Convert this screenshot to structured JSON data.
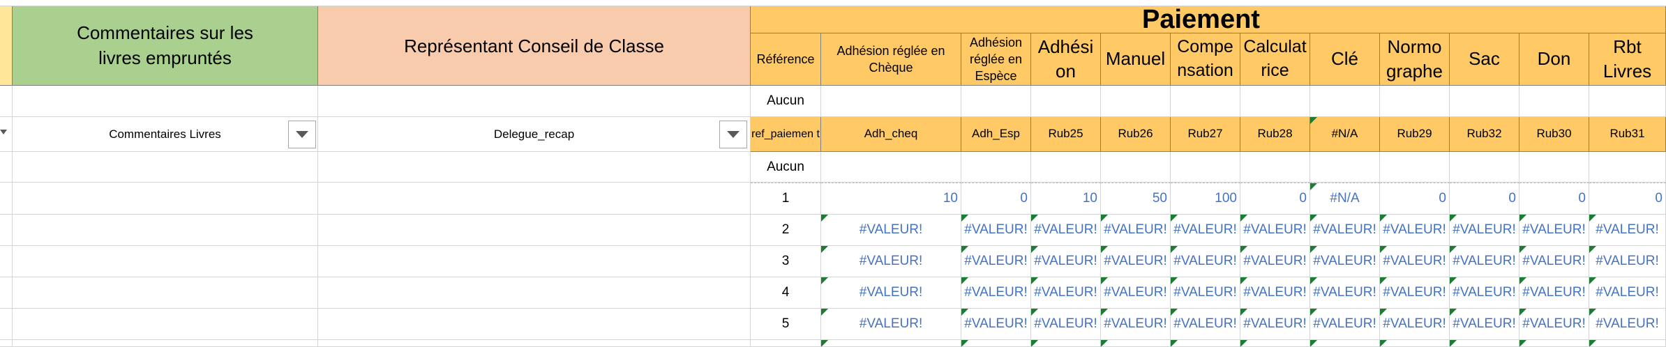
{
  "headers": {
    "commentaires": "Commentaires sur les livres empruntés",
    "representant": "Représentant Conseil de Classe",
    "paiement": "Paiement",
    "columns": [
      "Référence",
      "Adhésion réglée en Chèque",
      "Adhésion réglée en Espèce",
      "Adhési on",
      "Manuel",
      "Compe nsation",
      "Calculat rice",
      "Clé",
      "Normo graphe",
      "Sac",
      "Don",
      "Rbt Livres"
    ]
  },
  "rows": {
    "aucun_top": "Aucun",
    "dropdown_commentaires": "Commentaires Livres",
    "dropdown_delegue": "Delegue_recap",
    "codes": [
      "ref_paiemen t",
      "Adh_cheq",
      "Adh_Esp",
      "Rub25",
      "Rub26",
      "Rub27",
      "Rub28",
      "#N/A",
      "Rub29",
      "Rub32",
      "Rub30",
      "Rub31"
    ],
    "aucun_bottom": "Aucun",
    "data": [
      [
        "1",
        "10",
        "0",
        "10",
        "50",
        "100",
        "0",
        "#N/A",
        "0",
        "0",
        "0",
        "0"
      ],
      [
        "2",
        "#VALEUR!",
        "#VALEUR!",
        "#VALEUR!",
        "#VALEUR!",
        "#VALEUR!",
        "#VALEUR!",
        "#VALEUR!",
        "#VALEUR!",
        "#VALEUR!",
        "#VALEUR!",
        "#VALEUR!"
      ],
      [
        "3",
        "#VALEUR!",
        "#VALEUR!",
        "#VALEUR!",
        "#VALEUR!",
        "#VALEUR!",
        "#VALEUR!",
        "#VALEUR!",
        "#VALEUR!",
        "#VALEUR!",
        "#VALEUR!",
        "#VALEUR!"
      ],
      [
        "4",
        "#VALEUR!",
        "#VALEUR!",
        "#VALEUR!",
        "#VALEUR!",
        "#VALEUR!",
        "#VALEUR!",
        "#VALEUR!",
        "#VALEUR!",
        "#VALEUR!",
        "#VALEUR!",
        "#VALEUR!"
      ],
      [
        "5",
        "#VALEUR!",
        "#VALEUR!",
        "#VALEUR!",
        "#VALEUR!",
        "#VALEUR!",
        "#VALEUR!",
        "#VALEUR!",
        "#VALEUR!",
        "#VALEUR!",
        "#VALEUR!",
        "#VALEUR!"
      ]
    ]
  },
  "colors": {
    "orange": "#ffc966",
    "green": "#a9d08e",
    "salmon": "#f8cbad",
    "yellow": "#ffe699",
    "value_blue": "#4472c4",
    "error_triangle": "#1e7b34"
  }
}
